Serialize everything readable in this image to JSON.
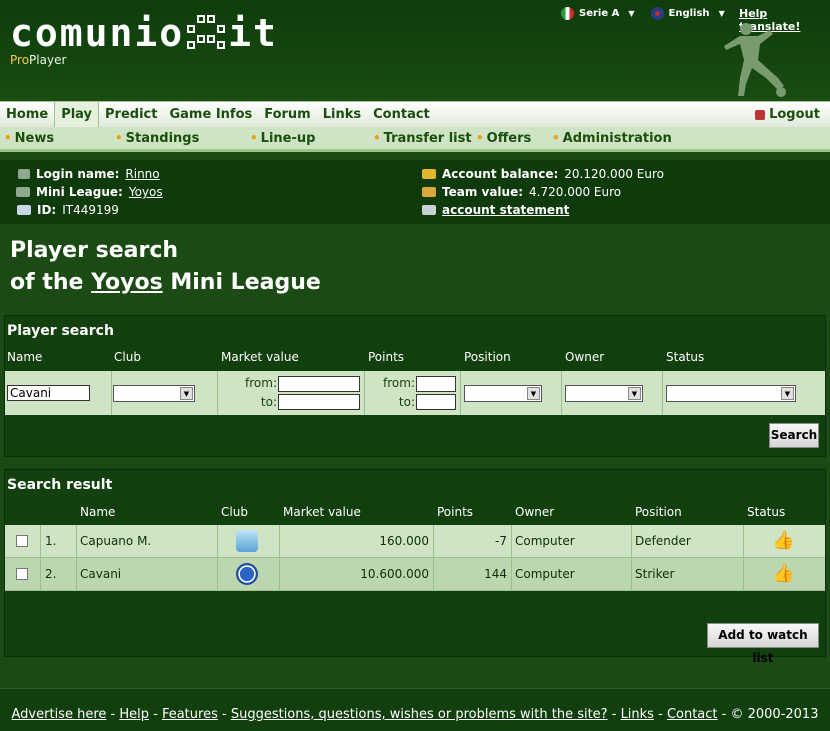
{
  "header": {
    "logo_text": "comunio",
    "logo_suffix": "it",
    "logo_sub_pro": "Pro",
    "logo_sub_player": "Player",
    "league_selector": "Serie A",
    "language_selector": "English",
    "help_translate": "Help translate!"
  },
  "nav": {
    "items": [
      "Home",
      "Play",
      "Predict",
      "Game Infos",
      "Forum",
      "Links",
      "Contact"
    ],
    "active": "Play",
    "logout": "Logout"
  },
  "subnav": {
    "items": [
      "News",
      "Standings",
      "Line-up",
      "Transfer list",
      "Offers",
      "Administration"
    ]
  },
  "account": {
    "login_label": "Login name:",
    "login_value": "Rinno",
    "league_label": "Mini League:",
    "league_value": "Yoyos",
    "id_label": "ID:",
    "id_value": "IT449199",
    "balance_label": "Account balance:",
    "balance_value": "20.120.000 Euro",
    "team_label": "Team value:",
    "team_value": "4.720.000 Euro",
    "statement_link": "account statement"
  },
  "heading": {
    "line1": "Player search",
    "line2_prefix": "of the",
    "line2_league": "Yoyos",
    "line2_suffix": "Mini League"
  },
  "search_panel": {
    "title": "Player search",
    "columns": [
      "Name",
      "Club",
      "Market value",
      "Points",
      "Position",
      "Owner",
      "Status"
    ],
    "name_value": "Cavani",
    "from_label": "from:",
    "to_label": "to:",
    "search_button": "Search"
  },
  "result_panel": {
    "title": "Search result",
    "columns": [
      "Name",
      "Club",
      "Market value",
      "Points",
      "Owner",
      "Position",
      "Status"
    ],
    "rows": [
      {
        "index": "1.",
        "name": "Capuano M.",
        "market_value": "160.000",
        "points": "-7",
        "owner": "Computer",
        "position": "Defender"
      },
      {
        "index": "2.",
        "name": "Cavani",
        "market_value": "10.600.000",
        "points": "144",
        "owner": "Computer",
        "position": "Striker"
      }
    ],
    "watch_button": "Add to watch list"
  },
  "footer": {
    "links": [
      "Advertise here",
      "Help",
      "Features",
      "Suggestions, questions, wishes or problems with the site?",
      "Links",
      "Contact"
    ],
    "copyright": "© 2000-2013"
  },
  "colors": {
    "page_bg": "#1c4a14",
    "nav_text": "#1a4f0e",
    "light_row": "#cfe4c4",
    "accent_dot": "#e8a216"
  }
}
